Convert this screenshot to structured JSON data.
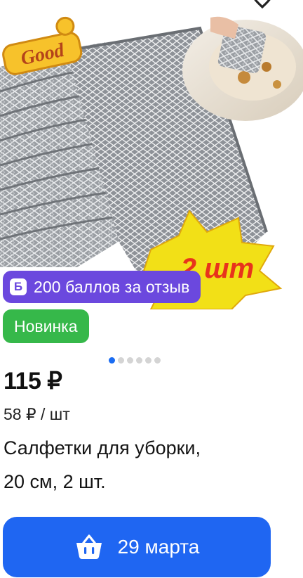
{
  "product": {
    "image": {
      "alt_icon": "product-photo",
      "sticker_good": "Good",
      "sticker_quantity": "2 шт"
    },
    "points_badge": {
      "icon_letter": "Б",
      "text": "200 баллов за отзыв",
      "color": "#6b48de"
    },
    "new_badge": {
      "text": "Новинка",
      "color": "#36b84a"
    },
    "gallery": {
      "total_images": 6,
      "active_index": 0
    },
    "price": "115 ₽",
    "unit_price": "58 ₽ / шт",
    "title_line_1": "Салфетки для уборки,",
    "title_line_2": "20 см, 2 шт.",
    "delivery_button": {
      "icon": "basket-icon",
      "label": "29 марта",
      "color": "#1f66f2"
    },
    "favorite_icon": "heart-icon"
  }
}
